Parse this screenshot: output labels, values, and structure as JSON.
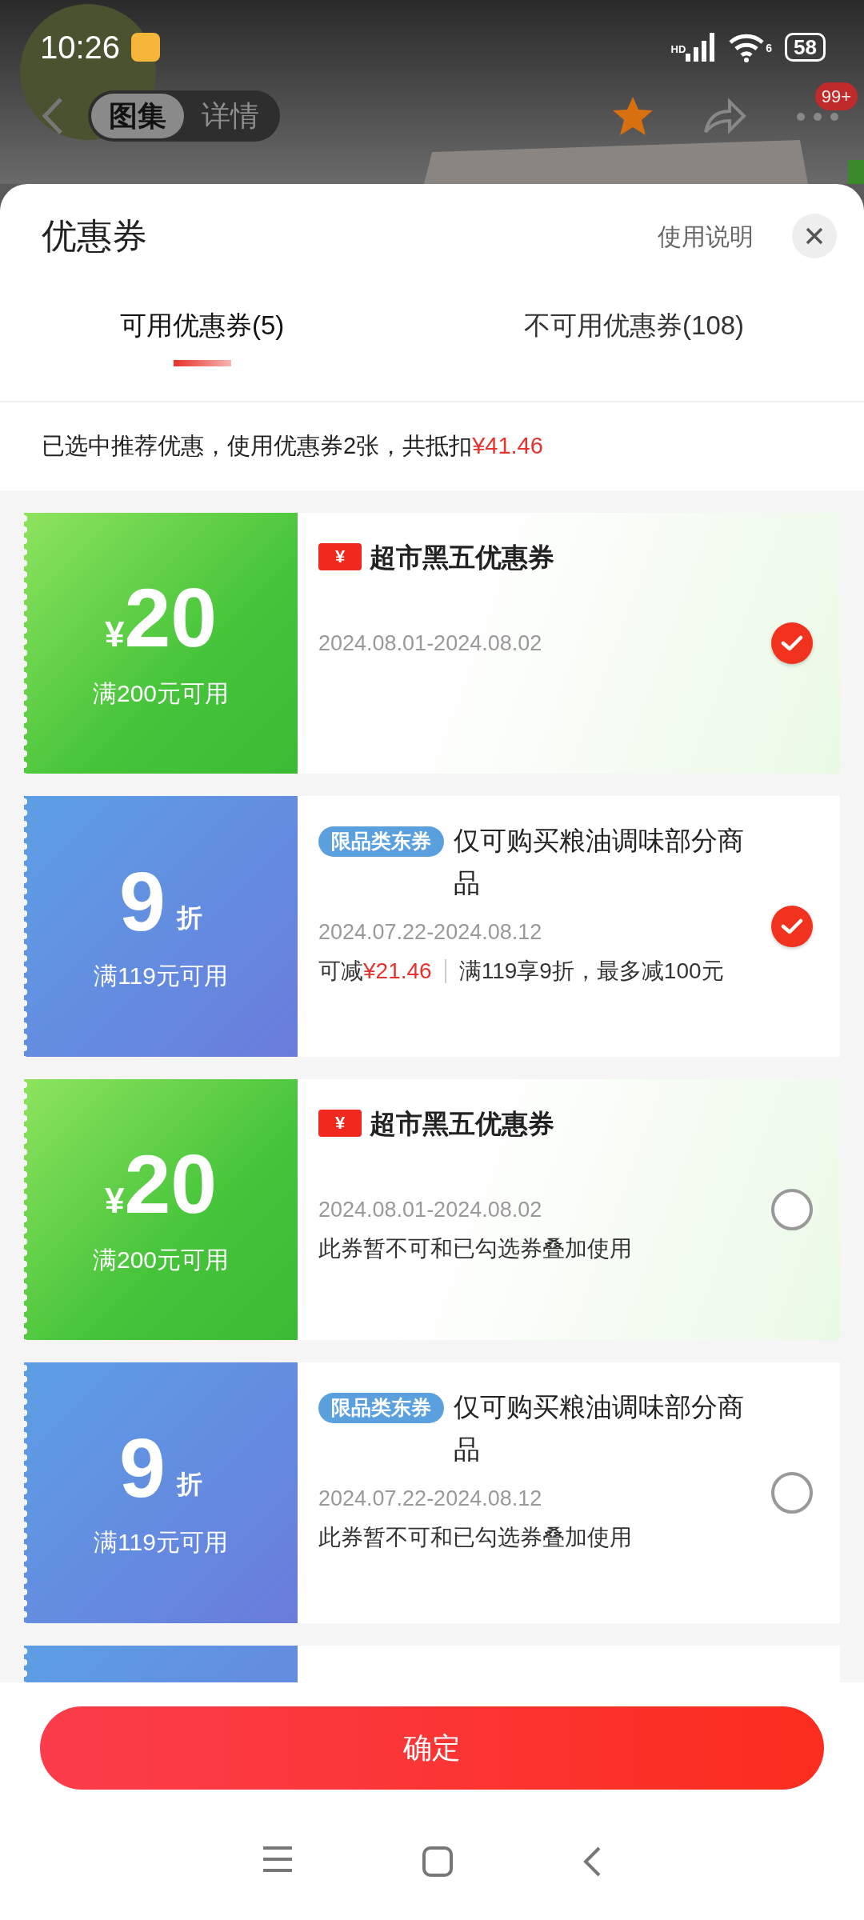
{
  "status_bar": {
    "time": "10:26",
    "network": "HD",
    "wifi_label": "6",
    "battery": "58"
  },
  "header": {
    "tabs": [
      {
        "label": "图集",
        "selected": true
      },
      {
        "label": "详情",
        "selected": false
      }
    ],
    "more_badge": "99+"
  },
  "sheet": {
    "title": "优惠券",
    "help_link": "使用说明",
    "tabs": [
      {
        "label": "可用优惠券(5)",
        "selected": true
      },
      {
        "label": "不可用优惠券(108)",
        "selected": false
      }
    ],
    "summary": {
      "text": "已选中推荐优惠，使用优惠券2张，共抵扣",
      "amount": "¥41.46"
    },
    "coupons": [
      {
        "kind": "cash",
        "currency": "¥",
        "amount": "20",
        "condition": "满200元可用",
        "tag": "¥",
        "title": "超市黑五优惠券",
        "dates": "2024.08.01-2024.08.02",
        "selected": true
      },
      {
        "kind": "discount",
        "amount": "9",
        "unit": "折",
        "condition": "满119元可用",
        "tag": "限品类东券",
        "title": "仅可购买粮油调味部分商品",
        "dates": "2024.07.22-2024.08.12",
        "saving_label": "可减",
        "saving_amount": "¥21.46",
        "rule": "满119享9折，最多减100元",
        "selected": true
      },
      {
        "kind": "cash",
        "currency": "¥",
        "amount": "20",
        "condition": "满200元可用",
        "tag": "¥",
        "title": "超市黑五优惠券",
        "dates": "2024.08.01-2024.08.02",
        "note": "此券暂不可和已勾选券叠加使用",
        "selected": false
      },
      {
        "kind": "discount",
        "amount": "9",
        "unit": "折",
        "condition": "满119元可用",
        "tag": "限品类东券",
        "title": "仅可购买粮油调味部分商品",
        "dates": "2024.07.22-2024.08.12",
        "note": "此券暂不可和已勾选券叠加使用",
        "selected": false
      },
      {
        "kind": "discount"
      }
    ],
    "confirm_button": "确定"
  }
}
